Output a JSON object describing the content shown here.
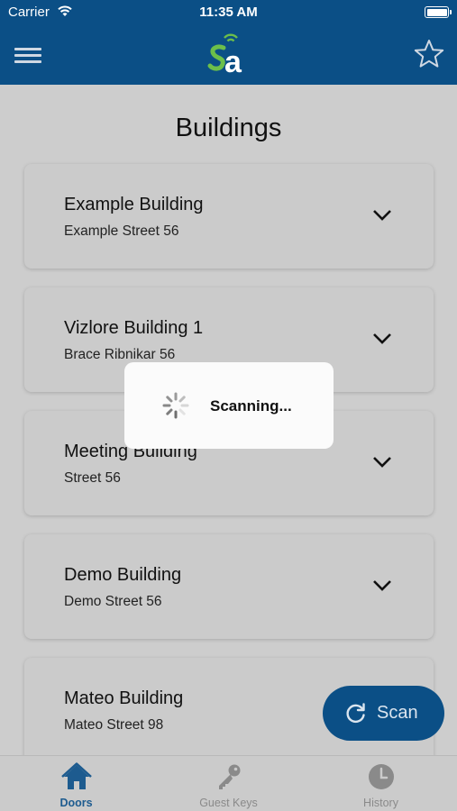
{
  "status_bar": {
    "carrier": "Carrier",
    "time": "11:35 AM"
  },
  "header": {
    "logo_text": "a",
    "menu_icon": "hamburger-menu-icon",
    "favorite_icon": "star-icon"
  },
  "page": {
    "title": "Buildings"
  },
  "buildings": [
    {
      "name": "Example Building",
      "street": "Example Street 56"
    },
    {
      "name": "Vizlore Building 1",
      "street": "Brace Ribnikar 56"
    },
    {
      "name": "Meeting Building",
      "street": "Street 56"
    },
    {
      "name": "Demo Building",
      "street": "Demo Street 56"
    },
    {
      "name": "Mateo Building",
      "street": "Mateo Street 98"
    }
  ],
  "scan_button": {
    "label": "Scan"
  },
  "tabs": [
    {
      "label": "Doors",
      "icon": "home-icon",
      "active": true
    },
    {
      "label": "Guest Keys",
      "icon": "key-icon",
      "active": false
    },
    {
      "label": "History",
      "icon": "clock-icon",
      "active": false
    }
  ],
  "dialog": {
    "text": "Scanning..."
  },
  "colors": {
    "brand": "#0b4f86",
    "logo_green": "#6cbf4a",
    "overlay": "#cdcdcd",
    "active_tab": "#1d5b8f"
  }
}
